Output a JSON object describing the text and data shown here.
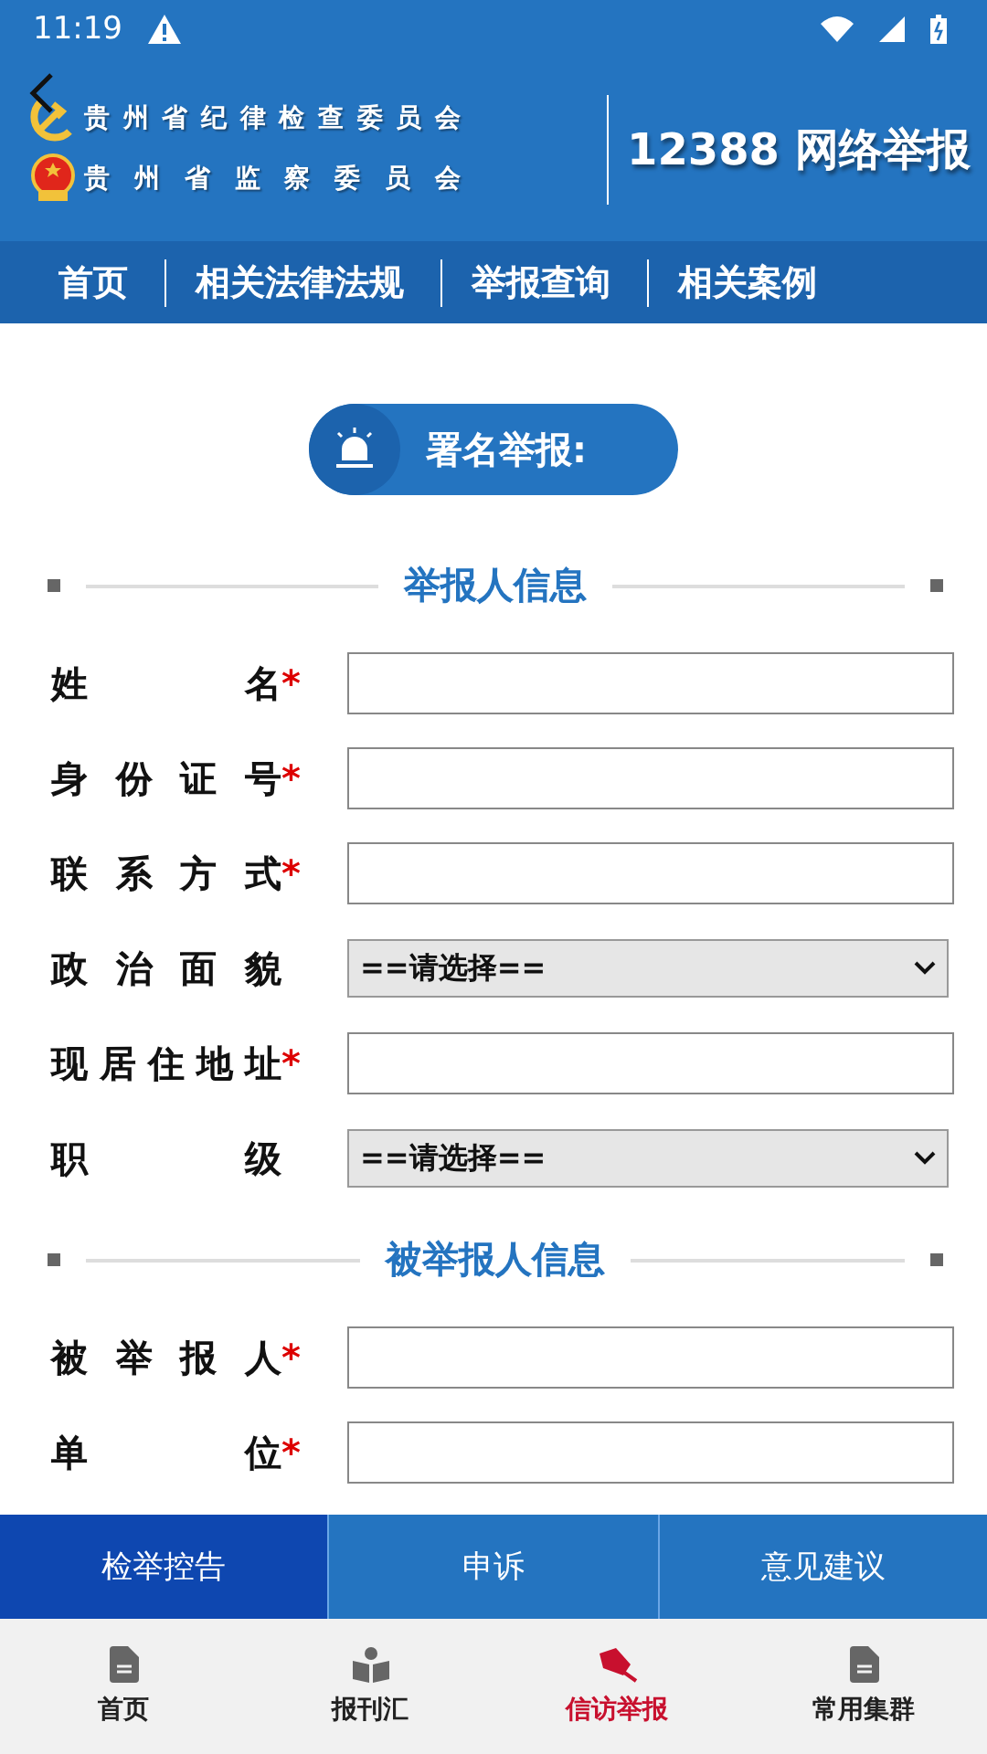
{
  "status_bar": {
    "time": "11:19"
  },
  "header": {
    "org_lines": [
      "贵州省纪律检查委员会",
      "贵州省监察委员会"
    ],
    "title": "12388 网络举报"
  },
  "nav": [
    {
      "label": "首页"
    },
    {
      "label": "相关法律法规"
    },
    {
      "label": "举报查询"
    },
    {
      "label": "相关案例"
    }
  ],
  "badge": {
    "label": "署名举报:"
  },
  "sections": [
    {
      "title": "举报人信息",
      "fields": [
        {
          "label": "姓名",
          "kind": "input",
          "required_mark": "*"
        },
        {
          "label": "身份证号",
          "kind": "input",
          "required_mark": "*"
        },
        {
          "label": "联系方式",
          "kind": "input",
          "required_mark": "*"
        },
        {
          "label": "政治面貌",
          "kind": "select",
          "value": "==请选择=="
        },
        {
          "label": "现居住地址",
          "kind": "input",
          "required_mark": "*"
        },
        {
          "label": "职级",
          "kind": "select",
          "value": "==请选择=="
        }
      ]
    },
    {
      "title": "被举报人信息",
      "fields": [
        {
          "label": "被举报人",
          "kind": "input",
          "required_mark": "*"
        },
        {
          "label": "单位",
          "kind": "input",
          "required_mark": "*"
        }
      ]
    }
  ],
  "type_tabs": [
    {
      "label": "检举控告",
      "selected": true
    },
    {
      "label": "申诉",
      "selected": false
    },
    {
      "label": "意见建议",
      "selected": false
    }
  ],
  "bottom_nav": [
    {
      "label": "首页",
      "selected": false
    },
    {
      "label": "报刊汇",
      "selected": false
    },
    {
      "label": "信访举报",
      "selected": true
    },
    {
      "label": "常用集群",
      "selected": false
    }
  ]
}
